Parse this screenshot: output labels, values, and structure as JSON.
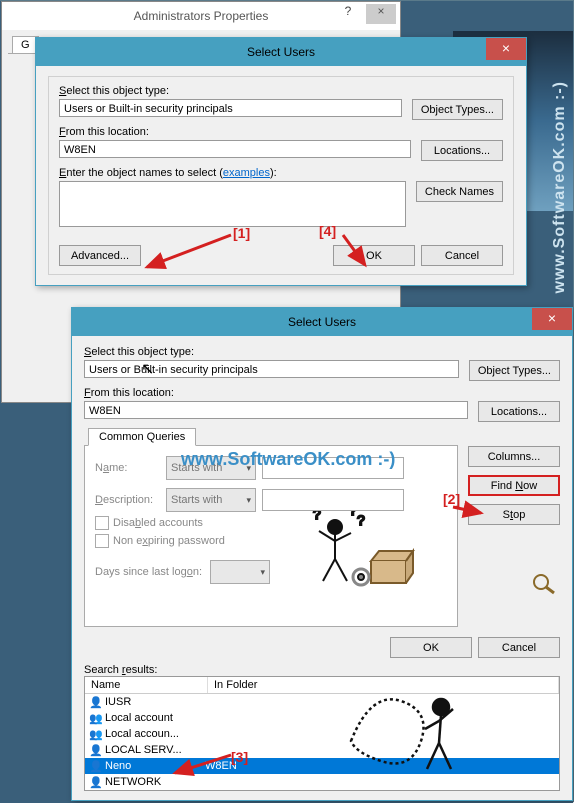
{
  "parent": {
    "title": "Administrators Properties",
    "tab": "G"
  },
  "dialog1": {
    "title": "Select Users",
    "label_object_type": "Select this object type:",
    "object_type_value": "Users or Built-in security principals",
    "btn_object_types": "Object Types...",
    "label_location": "From this location:",
    "location_value": "W8EN",
    "btn_locations": "Locations...",
    "label_names_prefix": "Enter the object names to select (",
    "examples": "examples",
    "label_names_suffix": "):",
    "btn_check_names": "Check Names",
    "btn_advanced": "Advanced...",
    "btn_ok": "OK",
    "btn_cancel": "Cancel"
  },
  "dialog2": {
    "title": "Select Users",
    "label_object_type": "Select this object type:",
    "object_type_value": "Users or Built-in security principals",
    "btn_object_types": "Object Types...",
    "label_location": "From this location:",
    "location_value": "W8EN",
    "btn_locations": "Locations...",
    "tab_common": "Common Queries",
    "label_name": "Name:",
    "label_description": "Description:",
    "starts_with": "Starts with",
    "chk_disabled": "Disabled accounts",
    "chk_nonexpiring": "Non expiring password",
    "label_days": "Days since last logon:",
    "btn_columns": "Columns...",
    "btn_find_now": "Find Now",
    "btn_stop": "Stop",
    "btn_ok": "OK",
    "btn_cancel": "Cancel",
    "label_search_results": "Search results:",
    "col_name": "Name",
    "col_folder": "In Folder",
    "results": [
      {
        "name": "IUSR",
        "folder": "",
        "type": "user"
      },
      {
        "name": "Local account",
        "folder": "",
        "type": "group"
      },
      {
        "name": "Local accoun...",
        "folder": "",
        "type": "group"
      },
      {
        "name": "LOCAL SERV...",
        "folder": "",
        "type": "user"
      },
      {
        "name": "Neno",
        "folder": "W8EN",
        "type": "user",
        "selected": true
      },
      {
        "name": "NETWORK",
        "folder": "",
        "type": "user"
      }
    ]
  },
  "annotations": {
    "a1": "[1]",
    "a2": "[2]",
    "a3": "[3]",
    "a4": "[4]"
  },
  "watermark": "www.SoftwareOK.com :-)",
  "watermark2": "www.SoftwareOK.com :-)"
}
